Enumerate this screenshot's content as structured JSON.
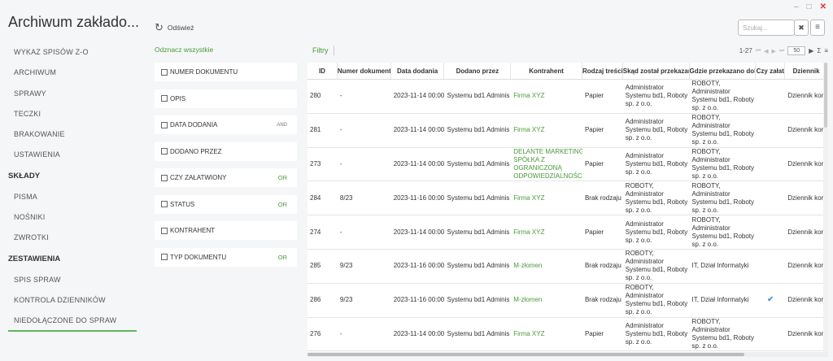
{
  "window": {
    "minimize": "–",
    "maximize": "□",
    "close": "✕"
  },
  "app": {
    "title": "Archiwum zakłado..."
  },
  "sidebar": {
    "items": [
      {
        "label": "WYKAZ SPISÓW Z-O",
        "type": "item"
      },
      {
        "label": "ARCHIWUM",
        "type": "item"
      },
      {
        "label": "SPRAWY",
        "type": "item"
      },
      {
        "label": "TECZKI",
        "type": "item"
      },
      {
        "label": "BRAKOWANIE",
        "type": "item"
      },
      {
        "label": "USTAWIENIA",
        "type": "item"
      },
      {
        "label": "SKŁADY",
        "type": "section"
      },
      {
        "label": "PISMA",
        "type": "item"
      },
      {
        "label": "NOŚNIKI",
        "type": "item"
      },
      {
        "label": "ZWROTKI",
        "type": "item"
      },
      {
        "label": "ZESTAWIENIA",
        "type": "section"
      },
      {
        "label": "SPIS SPRAW",
        "type": "item"
      },
      {
        "label": "KONTROLA DZIENNIKÓW",
        "type": "item"
      },
      {
        "label": "NIEDOŁĄCZONE DO SPRAW",
        "type": "item",
        "active": true
      }
    ]
  },
  "toolbar": {
    "refresh_label": "Odśwież",
    "deselect_all": "Odznacz wszystkie",
    "search_placeholder": "Szukaj...",
    "clear_icon": "✖",
    "menu_icon": "≡"
  },
  "filters": [
    {
      "label": "NUMER DOKUMENTU",
      "op": ""
    },
    {
      "label": "OPIS",
      "op": ""
    },
    {
      "label": "DATA DODANIA",
      "op": "AND"
    },
    {
      "label": "DODANO PRZEZ",
      "op": ""
    },
    {
      "label": "CZY ZAŁATWIONY",
      "op": "OR"
    },
    {
      "label": "STATUS",
      "op": "OR"
    },
    {
      "label": "KONTRAHENT",
      "op": ""
    },
    {
      "label": "TYP DOKUMENTU",
      "op": "OR"
    }
  ],
  "grid_toolbar": {
    "filters_label": "Filtry",
    "range": "1-27",
    "page_size": "50"
  },
  "grid": {
    "columns": [
      "ID",
      "Numer dokument",
      "Data dodania",
      "Dodano przez",
      "Kontrahent",
      "Rodzaj treści",
      "Skąd został przekazan",
      "Gdzie przekazano dok",
      "Czy załat",
      "Dziennik"
    ],
    "rows": [
      {
        "id": "280",
        "num": "-",
        "date": "2023-11-14 00:00",
        "by": "Systemu bd1 Adminis",
        "kontrahent": "Firma XYZ",
        "rodzaj": "Papier",
        "skad": "Administrator Systemu bd1, Roboty sp. z o.o.",
        "gdzie": "ROBOTY, Administrator Systemu bd1, Roboty sp. z o.o.",
        "done": "",
        "dziennik": "Dziennik kores"
      },
      {
        "id": "281",
        "num": "-",
        "date": "2023-11-14 00:00",
        "by": "Systemu bd1 Adminis",
        "kontrahent": "Firma XYZ",
        "rodzaj": "Papier",
        "skad": "Administrator Systemu bd1, Roboty sp. z o.o.",
        "gdzie": "ROBOTY, Administrator Systemu bd1, Roboty sp. z o.o.",
        "done": "",
        "dziennik": "Dziennik kores"
      },
      {
        "id": "273",
        "num": "-",
        "date": "2023-11-14 00:00",
        "by": "Systemu bd1 Adminis",
        "kontrahent": "DELANTE MARKETING SPÓŁKA Z OGRANICZONĄ ODPOWIEDZIALNOŚCIĄ",
        "rodzaj": "Papier",
        "skad": "Administrator Systemu bd1, Roboty sp. z o.o.",
        "gdzie": "ROBOTY, Administrator Systemu bd1, Roboty sp. z o.o.",
        "done": "",
        "dziennik": "Dziennik kores"
      },
      {
        "id": "284",
        "num": "8/23",
        "date": "2023-11-16 00:00",
        "by": "Systemu bd1 Adminis",
        "kontrahent": "Firma XYZ",
        "rodzaj": "Brak rodzaju t",
        "skad": "ROBOTY, Administrator Systemu bd1, Roboty sp. z o.o.",
        "gdzie": "ROBOTY, Administrator Systemu bd1, Roboty sp. z o.o.",
        "done": "",
        "dziennik": "Dziennik kores"
      },
      {
        "id": "274",
        "num": "-",
        "date": "2023-11-14 00:00",
        "by": "Systemu bd1 Adminis",
        "kontrahent": "Firma XYZ",
        "rodzaj": "Papier",
        "skad": "Administrator Systemu bd1, Roboty sp. z o.o.",
        "gdzie": "ROBOTY, Administrator Systemu bd1, Roboty sp. z o.o.",
        "done": "",
        "dziennik": "Dziennik kores"
      },
      {
        "id": "285",
        "num": "9/23",
        "date": "2023-11-16 00:00",
        "by": "Systemu bd1 Adminis",
        "kontrahent": "M-złomen",
        "rodzaj": "Brak rodzaju t",
        "skad": "ROBOTY, Administrator Systemu bd1, Roboty sp. z o.o.",
        "gdzie": "IT, Dział Informatyki",
        "done": "",
        "dziennik": "Dziennik kores"
      },
      {
        "id": "286",
        "num": "9/23",
        "date": "2023-11-16 00:00",
        "by": "Systemu bd1 Adminis",
        "kontrahent": "M-złomen",
        "rodzaj": "Brak rodzaju t",
        "skad": "ROBOTY, Administrator Systemu bd1, Roboty sp. z o.o.",
        "gdzie": "IT, Dział Informatyki",
        "done": "✔",
        "dziennik": "Dziennik kores"
      },
      {
        "id": "276",
        "num": "-",
        "date": "2023-11-14 00:00",
        "by": "Systemu bd1 Adminis",
        "kontrahent": "Firma XYZ",
        "rodzaj": "Papier",
        "skad": "Administrator Systemu bd1, Roboty sp. z o.o.",
        "gdzie": "ROBOTY, Administrator Systemu bd1, Roboty sp. z o.o.",
        "done": "",
        "dziennik": "Dziennik kores"
      }
    ]
  }
}
